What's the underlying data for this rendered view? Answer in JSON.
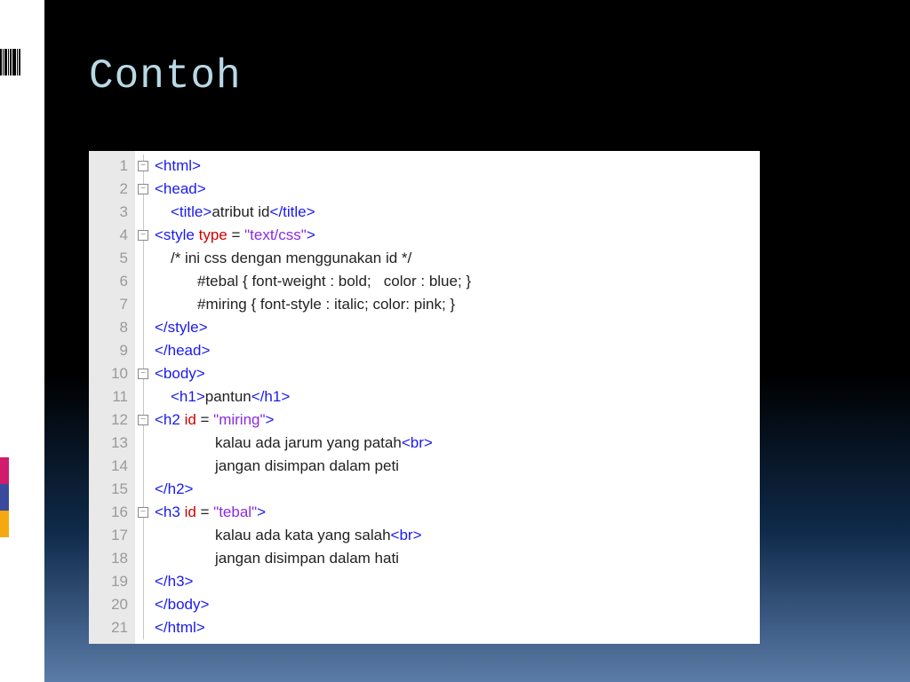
{
  "title": "Contoh",
  "accentColors": [
    "#d11b6b",
    "#3a4b9e",
    "#f5a80f"
  ],
  "lineNumbers": [
    "1",
    "2",
    "3",
    "4",
    "5",
    "6",
    "7",
    "8",
    "9",
    "10",
    "11",
    "12",
    "13",
    "14",
    "15",
    "16",
    "17",
    "18",
    "19",
    "20",
    "21"
  ],
  "fold": [
    "box",
    "box",
    "",
    "box",
    "",
    "",
    "",
    "",
    "",
    "box",
    "",
    "box",
    "",
    "",
    "",
    "box",
    "",
    "",
    "",
    "",
    ""
  ],
  "code": {
    "l1": {
      "open": "<html>"
    },
    "l2": {
      "open": "<head>"
    },
    "l3": {
      "open": "<title>",
      "text": "atribut id",
      "close": "</title>"
    },
    "l4": {
      "open": "<style ",
      "attr": "type",
      "eq": " = ",
      "val": "\"text/css\"",
      "end": ">"
    },
    "l5": {
      "text": "/* ini css dengan menggunakan id */"
    },
    "l6": {
      "text": "#tebal { font-weight : bold;   color : blue; }"
    },
    "l7": {
      "text": "#miring { font-style : italic; color: pink; }"
    },
    "l8": {
      "close": "</style>"
    },
    "l9": {
      "close": "</head>"
    },
    "l10": {
      "open": "<body>"
    },
    "l11": {
      "open": "<h1>",
      "text": "pantun",
      "close": "</h1>"
    },
    "l12": {
      "open": "<h2 ",
      "attr": "id",
      "eq": " = ",
      "val": "\"miring\"",
      "end": ">"
    },
    "l13": {
      "text": "kalau ada jarum yang patah",
      "br": "<br>"
    },
    "l14": {
      "text": "jangan disimpan dalam peti"
    },
    "l15": {
      "close": "</h2>"
    },
    "l16": {
      "open": "<h3 ",
      "attr": "id",
      "eq": " = ",
      "val": "\"tebal\"",
      "end": ">"
    },
    "l17": {
      "text": "kalau ada kata yang salah",
      "br": "<br>"
    },
    "l18": {
      "text": "jangan disimpan dalam hati"
    },
    "l19": {
      "close": "</h3>"
    },
    "l20": {
      "close": "</body>"
    },
    "l21": {
      "close": "</html>"
    }
  }
}
